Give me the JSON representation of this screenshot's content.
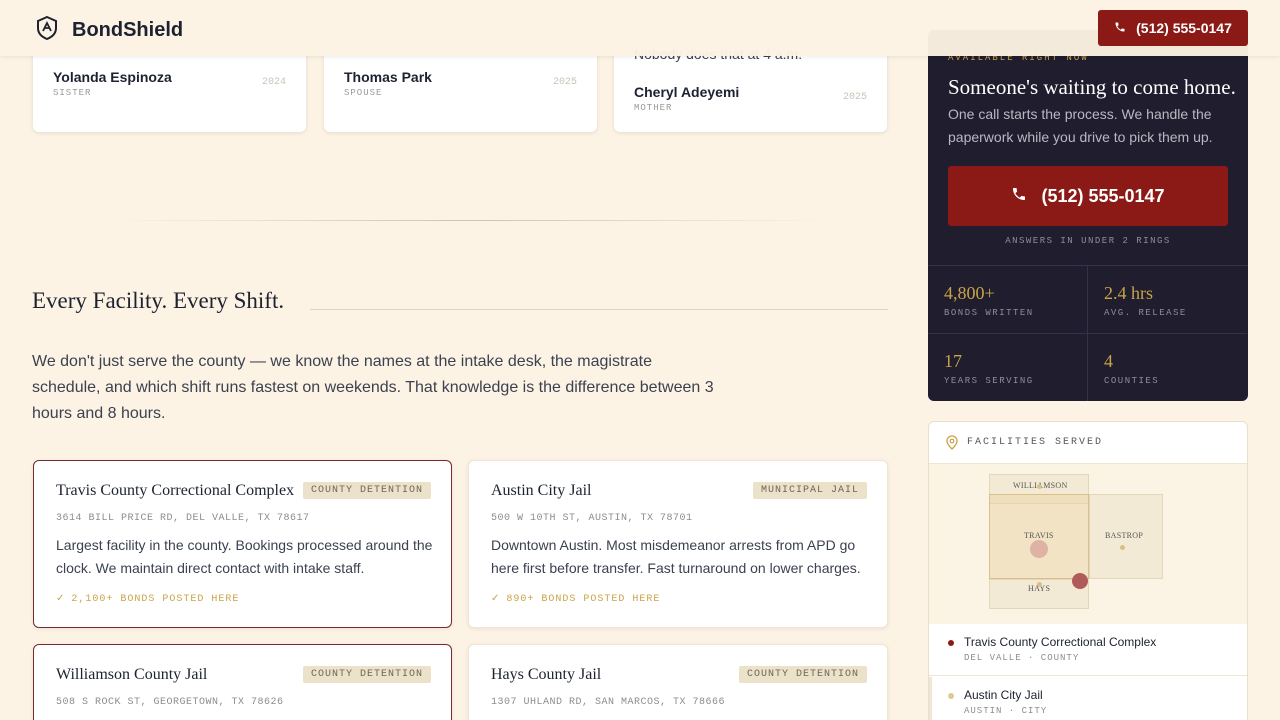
{
  "brand": {
    "name": "BondShield",
    "logo_icon": "shield-icon"
  },
  "header": {
    "phone_label": "(512) 555-0147",
    "phone_icon": "phone-icon"
  },
  "testimonials": [
    {
      "name": "Yolanda Espinoza",
      "relation": "SISTER",
      "year": "2024"
    },
    {
      "name": "Thomas Park",
      "relation": "SPOUSE",
      "year": "2025"
    },
    {
      "name": "Cheryl Adeyemi",
      "relation": "MOTHER",
      "year": "2025",
      "quote_tail": "Nobody does that at 4 a.m."
    }
  ],
  "section": {
    "title": "Every Facility. Every Shift.",
    "lead": "We don't just serve the county — we know the names at the intake desk, the magistrate schedule, and which shift runs fastest on weekends. That knowledge is the difference between 3 hours and 8 hours."
  },
  "facilities": [
    {
      "name": "Travis County Correctional Complex",
      "tag": "COUNTY DETENTION",
      "address": "3614 BILL PRICE RD, DEL VALLE, TX 78617",
      "description": "Largest facility in the county. Bookings processed around the clock. We maintain direct contact with intake staff.",
      "stat": "2,100+ BONDS POSTED HERE"
    },
    {
      "name": "Austin City Jail",
      "tag": "MUNICIPAL JAIL",
      "address": "500 W 10TH ST, AUSTIN, TX 78701",
      "description": "Downtown Austin. Most misdemeanor arrests from APD go here first before transfer. Fast turnaround on lower charges.",
      "stat": "890+ BONDS POSTED HERE"
    },
    {
      "name": "Williamson County Jail",
      "tag": "COUNTY DETENTION",
      "address": "508 S ROCK ST, GEORGETOWN, TX 78626"
    },
    {
      "name": "Hays County Jail",
      "tag": "COUNTY DETENTION",
      "address": "1307 UHLAND RD, SAN MARCOS, TX 78666"
    }
  ],
  "cta": {
    "kicker": "AVAILABLE RIGHT NOW",
    "title": "Someone's waiting to come home.",
    "subtitle": "One call starts the process. We handle the paperwork while you drive to pick them up.",
    "phone_label": "(512) 555-0147",
    "note": "ANSWERS IN UNDER 2 RINGS",
    "stats": [
      {
        "value": "4,800+",
        "label": "BONDS WRITTEN"
      },
      {
        "value": "2.4 hrs",
        "label": "AVG. RELEASE"
      },
      {
        "value": "17",
        "label": "YEARS SERVING"
      },
      {
        "value": "4",
        "label": "COUNTIES"
      }
    ]
  },
  "facilities_panel": {
    "title": "FACILITIES SERVED",
    "map_labels": {
      "williamson": "WILLIAMSON",
      "travis": "TRAVIS",
      "bastrop": "BASTROP",
      "hays": "HAYS"
    },
    "items": [
      {
        "name": "Travis County Correctional Complex",
        "meta": "DEL VALLE · COUNTY",
        "color": "#8b1a17"
      },
      {
        "name": "Austin City Jail",
        "meta": "AUSTIN · CITY",
        "color": "#e0c98c"
      }
    ]
  },
  "colors": {
    "accent": "#8b1a17",
    "gold": "#c9a447",
    "navy": "#1f1d2e",
    "background": "#fcf3e4"
  }
}
